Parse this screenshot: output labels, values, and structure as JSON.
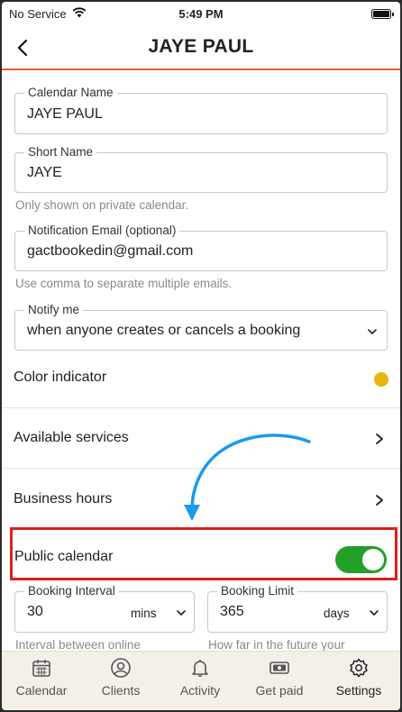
{
  "status_bar": {
    "carrier": "No Service",
    "time": "5:49 PM"
  },
  "header": {
    "title": "JAYE PAUL"
  },
  "calendar_name": {
    "label": "Calendar Name",
    "value": "JAYE PAUL"
  },
  "short_name": {
    "label": "Short Name",
    "value": "JAYE",
    "helper": "Only shown on private calendar."
  },
  "notification_email": {
    "label": "Notification Email (optional)",
    "value": "gactbookedin@gmail.com",
    "helper": "Use comma to separate multiple emails."
  },
  "notify_me": {
    "label": "Notify me",
    "value": "when anyone creates or cancels a booking"
  },
  "color_indicator": {
    "label": "Color indicator",
    "color": "#e6b40c"
  },
  "available_services": {
    "label": "Available services"
  },
  "business_hours": {
    "label": "Business hours"
  },
  "public_calendar": {
    "label": "Public calendar",
    "enabled": true
  },
  "booking_interval": {
    "label": "Booking Interval",
    "value": "30",
    "unit": "mins",
    "helper": "Interval between online"
  },
  "booking_limit": {
    "label": "Booking Limit",
    "value": "365",
    "unit": "days",
    "helper": "How far in the future your"
  },
  "tabs": [
    {
      "label": "Calendar",
      "icon": "calendar-icon"
    },
    {
      "label": "Clients",
      "icon": "person-icon"
    },
    {
      "label": "Activity",
      "icon": "bell-icon"
    },
    {
      "label": "Get paid",
      "icon": "money-icon"
    },
    {
      "label": "Settings",
      "icon": "gear-icon"
    }
  ],
  "colors": {
    "accent": "#ee5a24",
    "toggle_on": "#23a028",
    "highlight": "#e01f1f",
    "annotation_arrow": "#1a9be8"
  }
}
